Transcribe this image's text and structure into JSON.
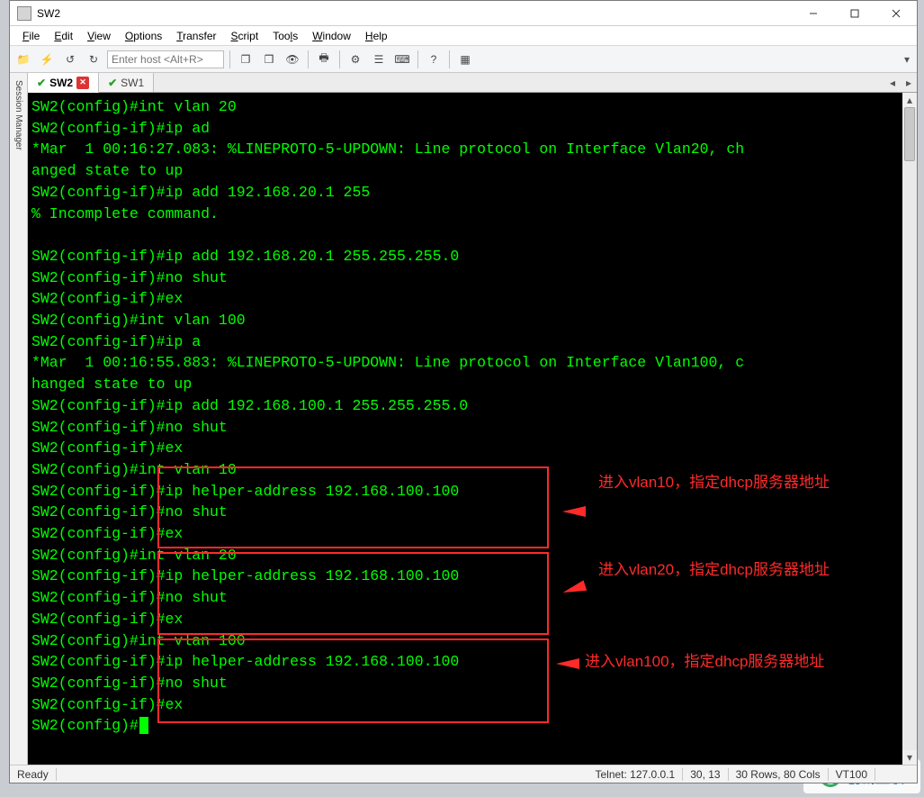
{
  "window": {
    "title": "SW2",
    "menus": [
      "File",
      "Edit",
      "View",
      "Options",
      "Transfer",
      "Script",
      "Tools",
      "Window",
      "Help"
    ],
    "host_placeholder": "Enter host <Alt+R>"
  },
  "session_tabs": {
    "active": {
      "label": "SW2"
    },
    "inactive": {
      "label": "SW1"
    }
  },
  "side_panel": {
    "label": "Session Manager"
  },
  "terminal": {
    "lines": [
      "SW2(config)#int vlan 20",
      "SW2(config-if)#ip ad",
      "*Mar  1 00:16:27.083: %LINEPROTO-5-UPDOWN: Line protocol on Interface Vlan20, ch",
      "anged state to up",
      "SW2(config-if)#ip add 192.168.20.1 255",
      "% Incomplete command.",
      "",
      "SW2(config-if)#ip add 192.168.20.1 255.255.255.0",
      "SW2(config-if)#no shut",
      "SW2(config-if)#ex",
      "SW2(config)#int vlan 100",
      "SW2(config-if)#ip a",
      "*Mar  1 00:16:55.883: %LINEPROTO-5-UPDOWN: Line protocol on Interface Vlan100, c",
      "hanged state to up",
      "SW2(config-if)#ip add 192.168.100.1 255.255.255.0",
      "SW2(config-if)#no shut",
      "SW2(config-if)#ex",
      "SW2(config)#int vlan 10",
      "SW2(config-if)#ip helper-address 192.168.100.100",
      "SW2(config-if)#no shut",
      "SW2(config-if)#ex",
      "SW2(config)#int vlan 20",
      "SW2(config-if)#ip helper-address 192.168.100.100",
      "SW2(config-if)#no shut",
      "SW2(config-if)#ex",
      "SW2(config)#int vlan 100",
      "SW2(config-if)#ip helper-address 192.168.100.100",
      "SW2(config-if)#no shut",
      "SW2(config-if)#ex",
      "SW2(config)#"
    ]
  },
  "statusbar": {
    "ready": "Ready",
    "telnet": "Telnet: 127.0.0.1",
    "cursor": "30,  13",
    "size": "30 Rows, 80 Cols",
    "emu": "VT100"
  },
  "annotations": {
    "note1": "进入vlan10，指定dhcp服务器地址",
    "note2": "进入vlan20，指定dhcp服务器地址",
    "note3": "进入vlan100，指定dhcp服务器地址"
  },
  "logo": "创新互联"
}
